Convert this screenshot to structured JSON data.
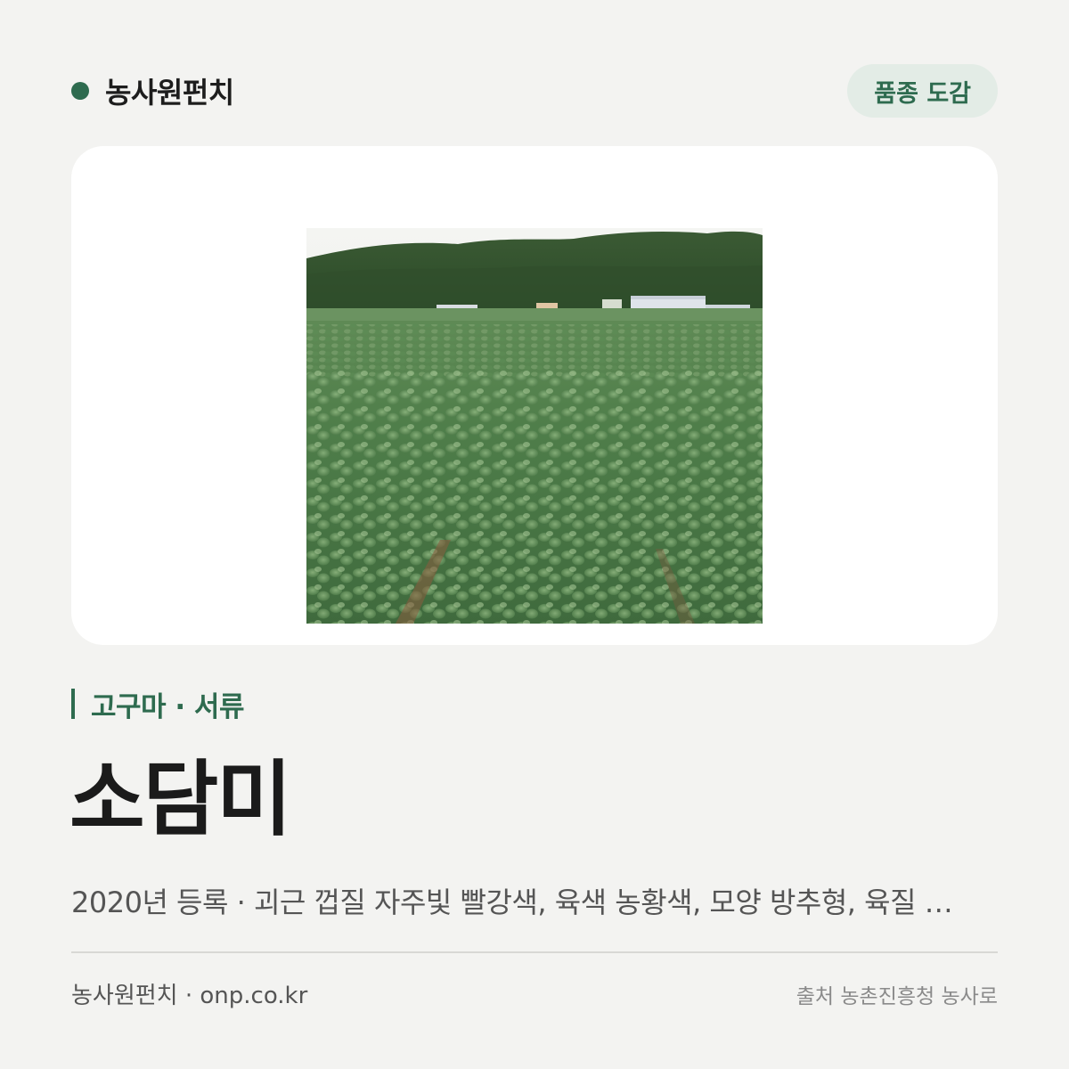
{
  "header": {
    "brand_name": "농사원펀치",
    "badge_label": "품종 도감"
  },
  "colors": {
    "accent": "#2e6b4f",
    "badge_bg": "#e3ece6",
    "background": "#f3f3f1",
    "card": "#ffffff"
  },
  "photo": {
    "subject": "sweet potato field with forested hill in background"
  },
  "variety": {
    "category": "고구마 · 서류",
    "name": "소담미",
    "description": "2020년 등록 · 괴근 껍질 자주빛 빨강색, 육색 농황색, 모양 방추형, 육질 …"
  },
  "footer": {
    "site": "농사원펀치 · onp.co.kr",
    "source": "출처 농촌진흥청 농사로"
  }
}
